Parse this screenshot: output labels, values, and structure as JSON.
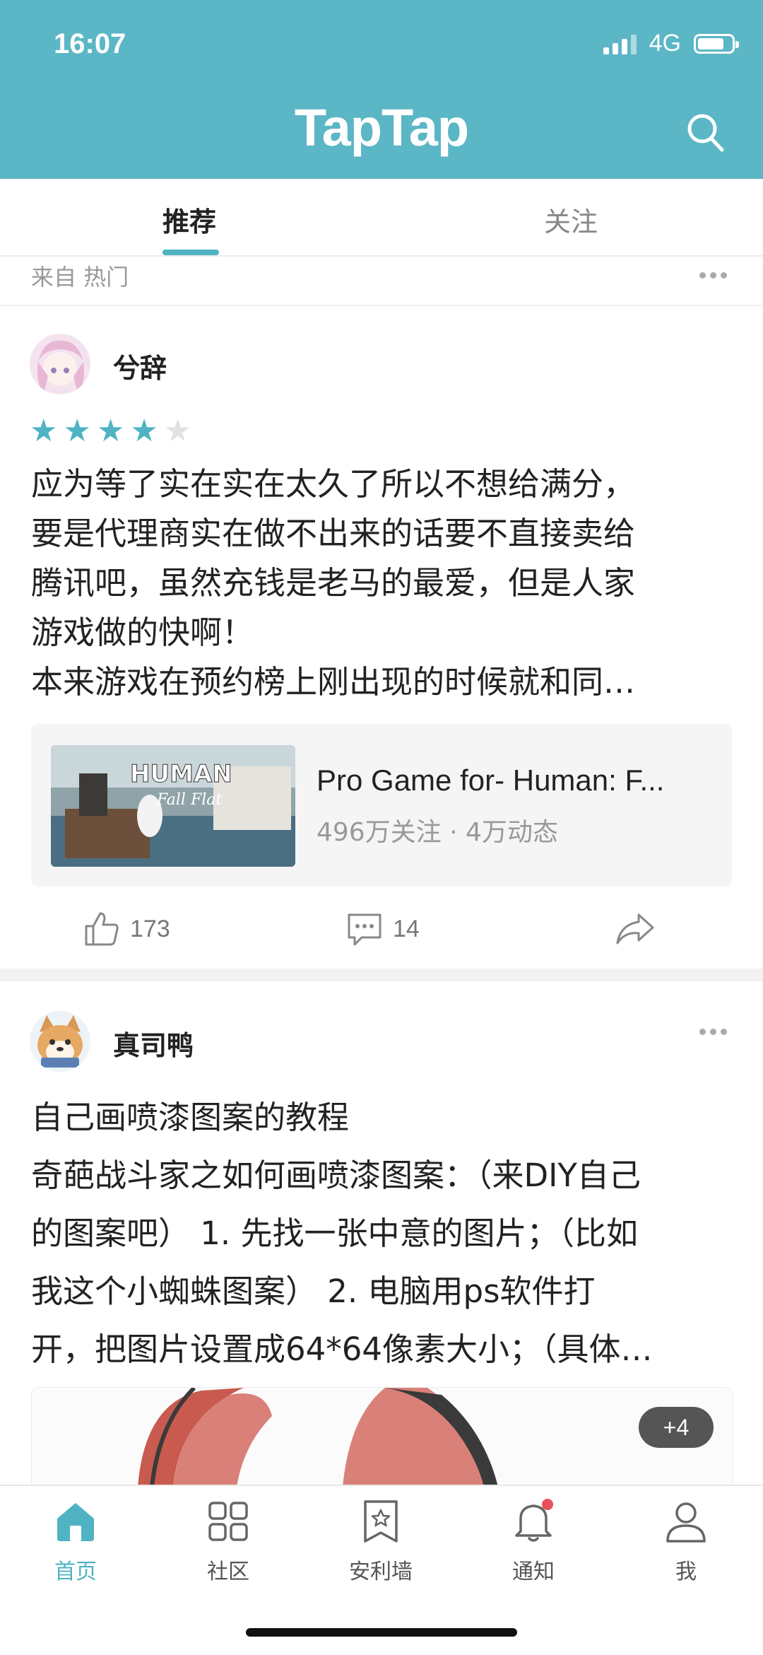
{
  "status_bar": {
    "time": "16:07",
    "network": "4G"
  },
  "header": {
    "logo": "TapTap"
  },
  "tabs": [
    {
      "label": "推荐",
      "active": true
    },
    {
      "label": "关注",
      "active": false
    }
  ],
  "feed": {
    "source_label": "来自 热门",
    "post1": {
      "username": "兮辞",
      "rating": 4,
      "rating_max": 5,
      "text_lines": [
        "应为等了实在实在太久了所以不想给满分，",
        "要是代理商实在做不出来的话要不直接卖给",
        "腾讯吧，虽然充钱是老马的最爱，但是人家",
        "游戏做的快啊！",
        "本来游戏在预约榜上刚出现的时候就和同…"
      ],
      "game": {
        "thumb_title": "HUMAN",
        "thumb_subtitle": "Fall Flat",
        "title": "Pro Game for- Human: F...",
        "stats": "496万关注 · 4万动态"
      },
      "likes": "173",
      "comments": "14"
    },
    "post2": {
      "username": "真司鸭",
      "text_lines": [
        "自己画喷漆图案的教程",
        "奇葩战斗家之如何画喷漆图案：（来DIY自己",
        "的图案吧） 1. 先找一张中意的图片；（比如",
        "我这个小蜘蛛图案）  2. 电脑用ps软件打",
        "开，把图片设置成64*64像素大小；（具体…"
      ],
      "more_images": "+4"
    }
  },
  "bottom_nav": [
    {
      "label": "首页",
      "icon": "home-icon",
      "active": true
    },
    {
      "label": "社区",
      "icon": "grid-icon",
      "active": false
    },
    {
      "label": "安利墙",
      "icon": "star-bookmark-icon",
      "active": false
    },
    {
      "label": "通知",
      "icon": "bell-icon",
      "active": false,
      "badge": true
    },
    {
      "label": "我",
      "icon": "user-icon",
      "active": false
    }
  ],
  "colors": {
    "brand": "#5bb6c5",
    "accent": "#4fb3c4",
    "badge": "#e8505b"
  }
}
